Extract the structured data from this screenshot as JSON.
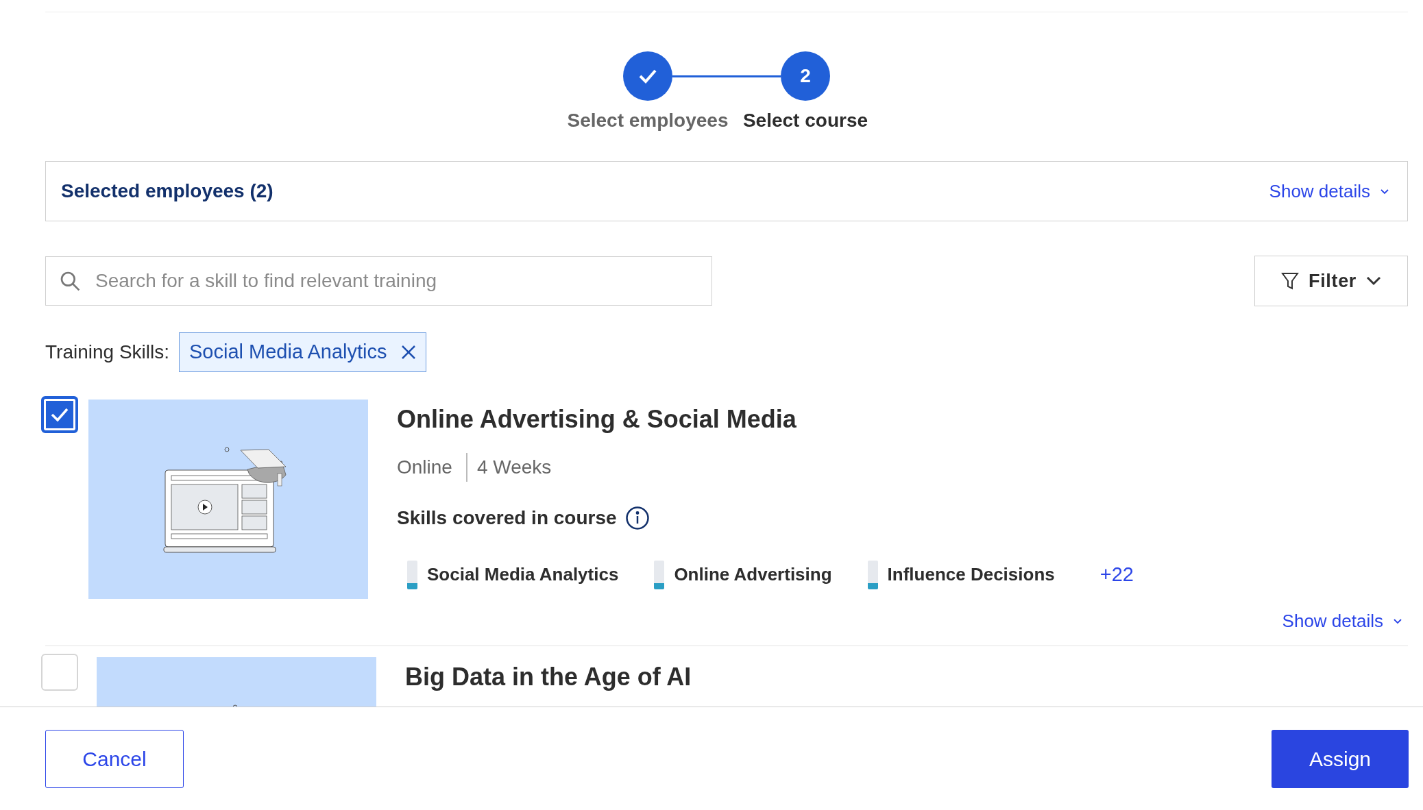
{
  "stepper": {
    "steps": [
      {
        "label": "Select employees",
        "completed": true,
        "selected": false
      },
      {
        "label": "Select course",
        "number": "2",
        "completed": false,
        "selected": true
      }
    ]
  },
  "selected_employees": {
    "title": "Selected employees (2)",
    "toggle": "Show details",
    "expanded": false
  },
  "search": {
    "placeholder": "Search for a skill to find relevant training"
  },
  "filter": {
    "label": "Filter"
  },
  "training_skills": {
    "label": "Training Skills:",
    "chips": [
      "Social Media Analytics"
    ]
  },
  "courses": [
    {
      "title": "Online Advertising & Social Media",
      "checked": true,
      "format": "Online",
      "duration": "4 Weeks",
      "skills_heading": "Skills covered in course",
      "skills": [
        {
          "name": "Social Media Analytics",
          "level": 0.2
        },
        {
          "name": "Online Advertising",
          "level": 0.2
        },
        {
          "name": "Influence Decisions",
          "level": 0.2
        }
      ],
      "more": "+22",
      "toggle": "Show details"
    },
    {
      "title": "Big Data in the Age of AI",
      "checked": false
    }
  ],
  "footer": {
    "cancel": "Cancel",
    "assign": "Assign"
  }
}
